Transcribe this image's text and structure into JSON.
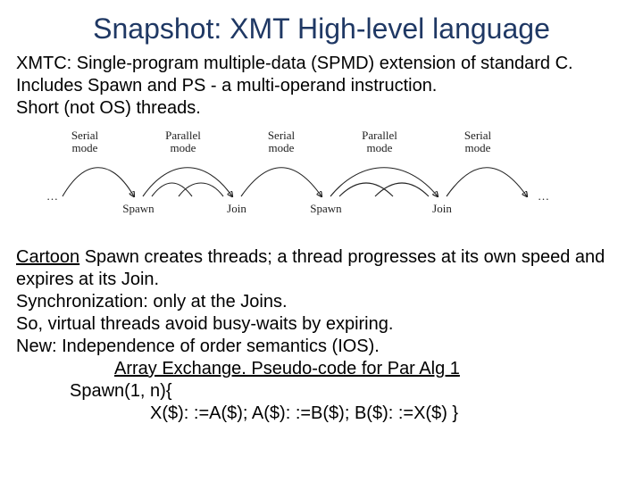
{
  "title": "Snapshot: XMT High-level language",
  "intro": {
    "line1": "XMTC: Single-program multiple-data (SPMD) extension of standard C.",
    "line2": "Includes Spawn and PS - a multi-operand instruction.",
    "line3": "Short (not OS) threads."
  },
  "diagram": {
    "serial_mode": "Serial\nmode",
    "parallel_mode": "Parallel\nmode",
    "spawn": "Spawn",
    "join": "Join",
    "ellipsis": "…"
  },
  "lower": {
    "cartoon_label": "Cartoon",
    "cartoon_rest": " Spawn creates threads; a thread progresses at its own speed and expires at its Join.",
    "sync": "Synchronization: only at the Joins.",
    "so": "So, virtual threads avoid busy-waits by expiring.",
    "new": "New: Independence of order semantics (IOS).",
    "heading2": "Array Exchange. Pseudo-code for Par Alg 1",
    "code1": "Spawn(1, n){",
    "code2": "X($): :=A($); A($): :=B($); B($): :=X($) }"
  }
}
